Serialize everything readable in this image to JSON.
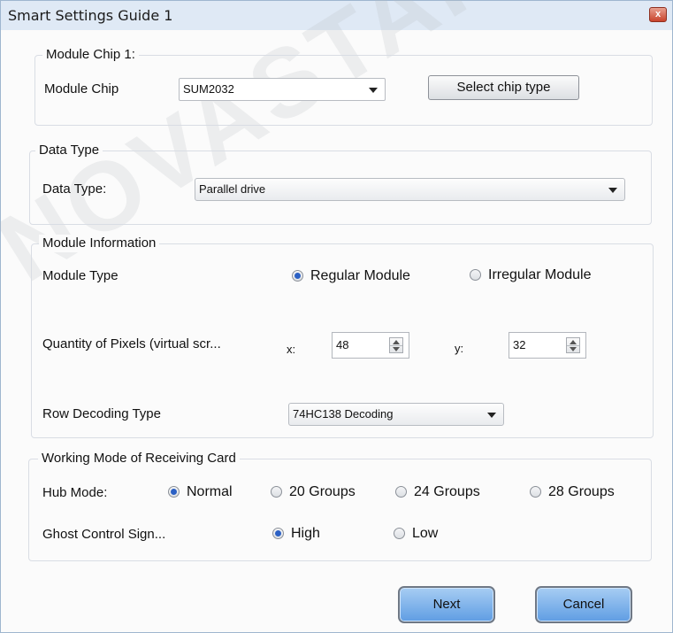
{
  "window": {
    "title": "Smart Settings Guide 1",
    "close_icon": "close-icon",
    "close_glyph": "x"
  },
  "watermark": "NOVASTAR",
  "module_chip_group": {
    "legend": "Module Chip 1:",
    "label": "Module Chip",
    "chip_value": "SUM2032",
    "select_button": "Select chip type"
  },
  "data_type_group": {
    "legend": "Data Type",
    "label": "Data Type:",
    "value": "Parallel drive"
  },
  "module_info_group": {
    "legend": "Module Information",
    "module_type_label": "Module Type",
    "regular_module": "Regular Module",
    "irregular_module": "Irregular Module",
    "selected_module_type": "Regular Module",
    "pixels_label": "Quantity of Pixels (virtual scr...",
    "x_label": "x:",
    "x_value": "48",
    "y_label": "y:",
    "y_value": "32",
    "row_decoding_label": "Row Decoding Type",
    "row_decoding_value": "74HC138 Decoding"
  },
  "working_mode_group": {
    "legend": "Working Mode of Receiving Card",
    "hub_mode_label": "Hub Mode:",
    "hub_options": [
      "Normal",
      "20 Groups",
      "24 Groups",
      "28 Groups"
    ],
    "hub_selected": "Normal",
    "ghost_label": "Ghost Control Sign...",
    "ghost_options": [
      "High",
      "Low"
    ],
    "ghost_selected": "High"
  },
  "buttons": {
    "next": "Next",
    "cancel": "Cancel"
  },
  "colors": {
    "titlebar": "#dfe9f5",
    "accent_button": "#5f9de3",
    "radio_selected": "#2b60c4",
    "close_button": "#c9432c"
  }
}
